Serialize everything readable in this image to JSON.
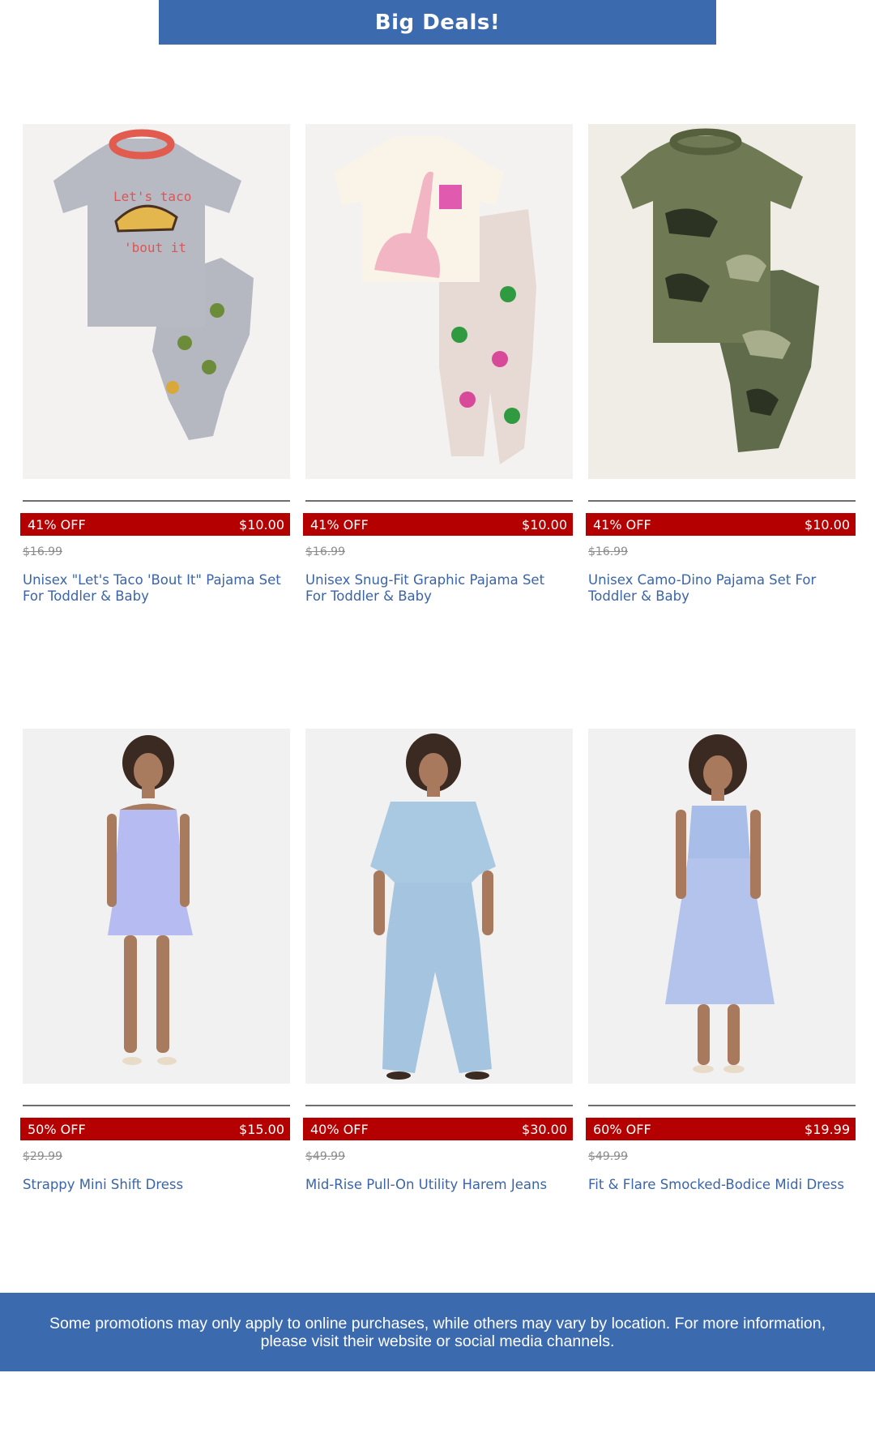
{
  "header": {
    "title": "Big Deals!",
    "color": "#3c6aae"
  },
  "products": [
    {
      "discount": "41% OFF",
      "price": "$10.00",
      "old_price": "$16.99",
      "name": "Unisex \"Let's Taco 'Bout It\" Pajama Set For Toddler & Baby",
      "image": "taco-pajama-set-image"
    },
    {
      "discount": "41% OFF",
      "price": "$10.00",
      "old_price": "$16.99",
      "name": "Unisex Snug-Fit Graphic Pajama Set For Toddler & Baby",
      "image": "dino-pajama-set-image"
    },
    {
      "discount": "41% OFF",
      "price": "$10.00",
      "old_price": "$16.99",
      "name": "Unisex Camo-Dino Pajama Set For Toddler & Baby",
      "image": "camo-pajama-set-image"
    },
    {
      "discount": "50% OFF",
      "price": "$15.00",
      "old_price": "$29.99",
      "name": "Strappy Mini Shift Dress",
      "image": "mini-dress-image"
    },
    {
      "discount": "40% OFF",
      "price": "$30.00",
      "old_price": "$49.99",
      "name": "Mid-Rise Pull-On Utility Harem Jeans",
      "image": "harem-jeans-image"
    },
    {
      "discount": "60% OFF",
      "price": "$19.99",
      "old_price": "$49.99",
      "name": "Fit & Flare Smocked-Bodice Midi Dress",
      "image": "midi-dress-image"
    }
  ],
  "footer": {
    "text": "Some promotions may only apply to online purchases, while others may vary by location. For more information, please visit their website or social media channels."
  },
  "colors": {
    "deal_red": "#b50000",
    "link_blue": "#3b64a8",
    "band_blue": "#3c6aae"
  }
}
